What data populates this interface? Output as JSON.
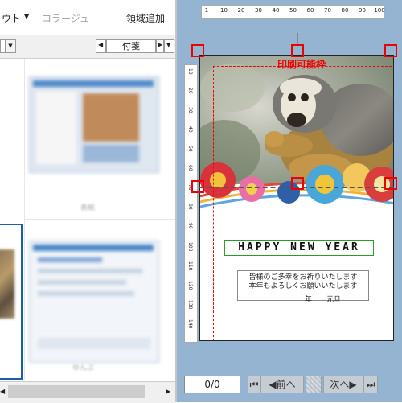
{
  "toolbar": {
    "layout_label": "ウト",
    "collage_label": "コラージュ",
    "add_area_label": "領域追加"
  },
  "filter": {
    "left_combo_value": "",
    "category_combo_value": "付箋"
  },
  "thumbnails": {
    "thumb2_caption": "表紙",
    "thumb4_caption": "ゆんぶ"
  },
  "card": {
    "print_area_label": "印刷可能枠",
    "headline": "HAPPY NEW YEAR",
    "message_line1": "皆様のご多幸をお祈りいたします",
    "message_line2": "本年もよろしくお願いいたします",
    "date_line": "年　　元旦"
  },
  "hruler": {
    "ticks": [
      "1",
      "10",
      "20",
      "30",
      "40",
      "50",
      "60",
      "70",
      "80",
      "90",
      "100"
    ]
  },
  "vruler": {
    "ticks": [
      "10",
      "20",
      "30",
      "40",
      "50",
      "60",
      "70",
      "80",
      "90",
      "100",
      "110",
      "120",
      "130",
      "140"
    ]
  },
  "footer": {
    "page_counter": "0/0",
    "prev_label": "前へ",
    "next_label": "次へ"
  },
  "colors": {
    "panel_blue": "#95b4d2",
    "handle_red": "#e00000",
    "print_frame_red": "#e00000",
    "headline_border": "#2a9a2a",
    "selection_blue": "#1a5fa8"
  }
}
